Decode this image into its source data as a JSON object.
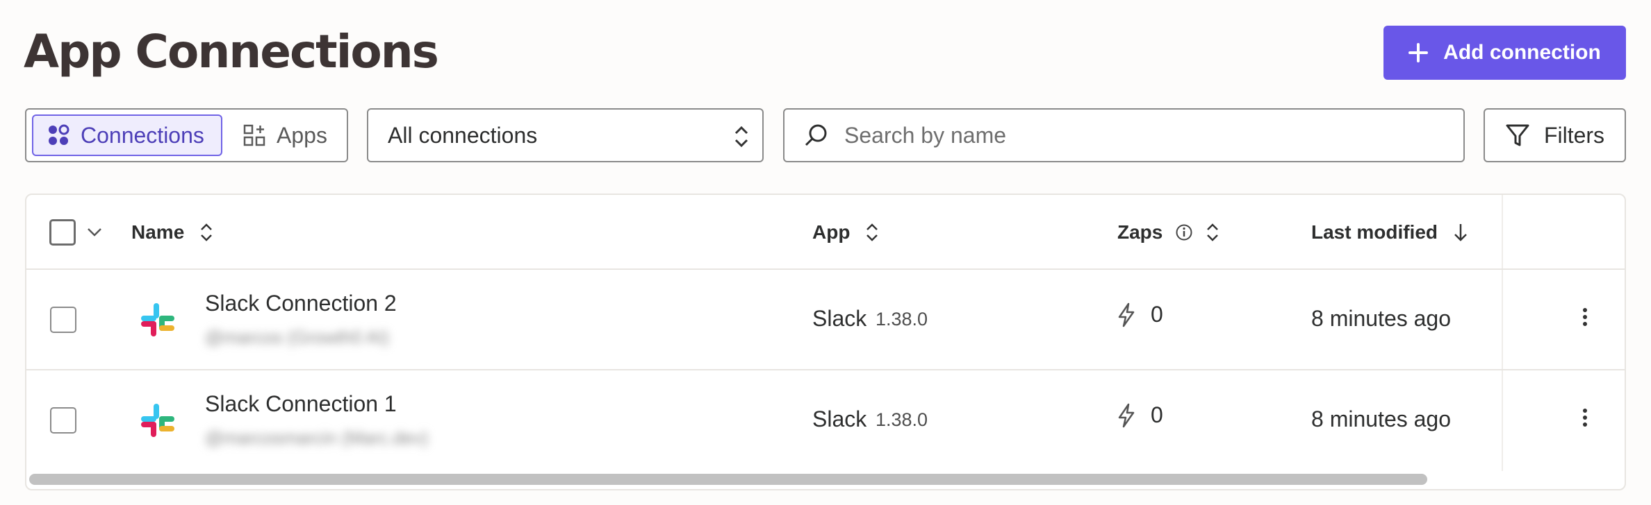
{
  "page": {
    "title": "App Connections",
    "add_button_label": "Add connection"
  },
  "toolbar": {
    "view_toggle": [
      {
        "label": "Connections",
        "selected": true,
        "icon": "connections-icon"
      },
      {
        "label": "Apps",
        "selected": false,
        "icon": "apps-grid-icon"
      }
    ],
    "filter_select": {
      "value": "All connections"
    },
    "search": {
      "placeholder": "Search by name",
      "value": ""
    },
    "filters_label": "Filters"
  },
  "table": {
    "columns": [
      {
        "label": "Name",
        "sort_icon": "sort-icon"
      },
      {
        "label": "App",
        "sort_icon": "sort-icon"
      },
      {
        "label": "Zaps",
        "info_icon": "info-icon",
        "sort_icon": "sort-icon"
      },
      {
        "label": "Last modified",
        "sort_icon": "arrow-down-icon"
      }
    ],
    "rows": [
      {
        "name": "Slack Connection 2",
        "subtitle": "@marcos (Growth0 AI)",
        "app": "Slack",
        "version": "1.38.0",
        "zaps": "0",
        "last_modified": "8 minutes ago"
      },
      {
        "name": "Slack Connection 1",
        "subtitle": "@marcosmarcin (Marc.dev)",
        "app": "Slack",
        "version": "1.38.0",
        "zaps": "0",
        "last_modified": "8 minutes ago"
      }
    ]
  },
  "colors": {
    "accent": "#6957e8",
    "selected_bg": "#efedfd",
    "selected_text": "#4d3fb8",
    "title": "#3d3434"
  }
}
